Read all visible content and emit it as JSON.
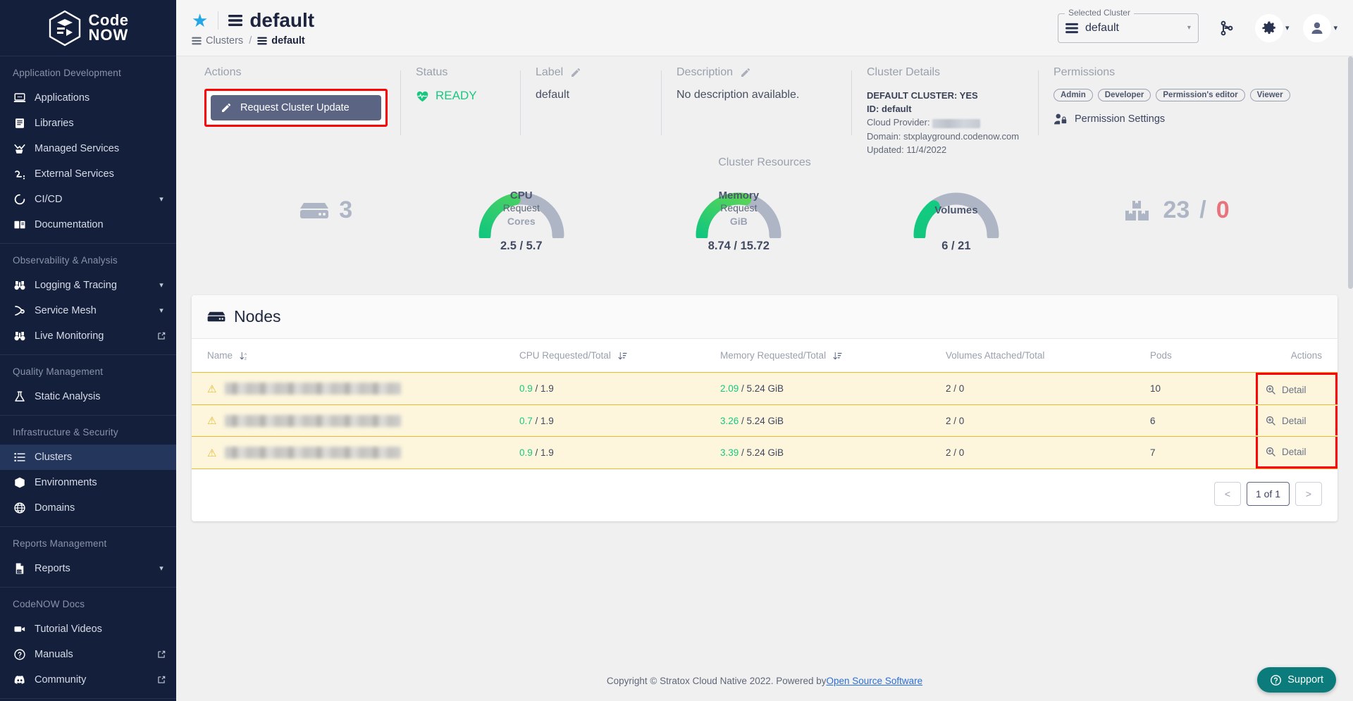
{
  "brand": {
    "name_line1": "Code",
    "name_line2": "NOW"
  },
  "sidebar": {
    "sections": [
      {
        "label": "Application Development",
        "items": [
          {
            "label": "Applications",
            "icon": "laptop-code-icon",
            "tail": ""
          },
          {
            "label": "Libraries",
            "icon": "book-icon",
            "tail": ""
          },
          {
            "label": "Managed Services",
            "icon": "managed-services-icon",
            "tail": ""
          },
          {
            "label": "External Services",
            "icon": "external-services-icon",
            "tail": ""
          },
          {
            "label": "CI/CD",
            "icon": "circle-loop-icon",
            "tail": "chevron-down-icon"
          },
          {
            "label": "Documentation",
            "icon": "open-book-icon",
            "tail": ""
          }
        ]
      },
      {
        "label": "Observability & Analysis",
        "items": [
          {
            "label": "Logging & Tracing",
            "icon": "binoculars-icon",
            "tail": "chevron-down-icon"
          },
          {
            "label": "Service Mesh",
            "icon": "service-mesh-icon",
            "tail": "chevron-down-icon"
          },
          {
            "label": "Live Monitoring",
            "icon": "binoculars-icon",
            "tail": "external-link-icon"
          }
        ]
      },
      {
        "label": "Quality Management",
        "items": [
          {
            "label": "Static Analysis",
            "icon": "flask-icon",
            "tail": ""
          }
        ]
      },
      {
        "label": "Infrastructure & Security",
        "items": [
          {
            "label": "Clusters",
            "icon": "list-icon",
            "tail": "",
            "active": true
          },
          {
            "label": "Environments",
            "icon": "cube-icon",
            "tail": ""
          },
          {
            "label": "Domains",
            "icon": "globe-icon",
            "tail": ""
          }
        ]
      },
      {
        "label": "Reports Management",
        "items": [
          {
            "label": "Reports",
            "icon": "csv-file-icon",
            "tail": "chevron-down-icon"
          }
        ]
      },
      {
        "label": "CodeNOW Docs",
        "items": [
          {
            "label": "Tutorial Videos",
            "icon": "video-camera-icon",
            "tail": ""
          },
          {
            "label": "Manuals",
            "icon": "question-circle-icon",
            "tail": "external-link-icon"
          },
          {
            "label": "Community",
            "icon": "discord-icon",
            "tail": "external-link-icon"
          }
        ]
      }
    ]
  },
  "header": {
    "title": "default",
    "favorite_icon": "star-icon",
    "breadcrumb": [
      {
        "label": "Clusters",
        "icon": "list-icon"
      },
      {
        "label": "default",
        "icon": "list-icon"
      }
    ],
    "breadcrumb_separator": "/",
    "selected_cluster": {
      "legend": "Selected Cluster",
      "value": "default"
    },
    "actions": [
      {
        "name": "git-branch-icon"
      },
      {
        "name": "gear-icon"
      },
      {
        "name": "user-icon"
      }
    ]
  },
  "info": {
    "actions": {
      "heading": "Actions",
      "button_label": "Request Cluster Update"
    },
    "status": {
      "heading": "Status",
      "value": "READY"
    },
    "label": {
      "heading": "Label",
      "value": "default"
    },
    "description": {
      "heading": "Description",
      "value": "No description available."
    },
    "cluster_details": {
      "heading": "Cluster Details",
      "default_cluster": "DEFAULT CLUSTER: YES",
      "id": "ID: default",
      "cloud_provider_label": "Cloud Provider:",
      "cloud_provider_value": "",
      "domain": "Domain: stxplayground.codenow.com",
      "updated": "Updated: 11/4/2022"
    },
    "permissions": {
      "heading": "Permissions",
      "chips": [
        "Admin",
        "Developer",
        "Permission's editor",
        "Viewer"
      ],
      "settings_label": "Permission Settings"
    }
  },
  "resources": {
    "title": "Cluster Resources",
    "nodes": {
      "icon": "server-icon",
      "count": "3"
    },
    "gauges": [
      {
        "name": "CPU",
        "sub": "Request",
        "unit": "Cores",
        "value": "2.5 / 5.7",
        "percent": 44
      },
      {
        "name": "Memory",
        "sub": "Request",
        "unit": "GiB",
        "value": "8.74 / 15.72",
        "percent": 56
      },
      {
        "name": "Volumes",
        "sub": "",
        "unit": "",
        "value": "6 / 21",
        "percent": 29
      }
    ],
    "pods": {
      "icon": "boxes-icon",
      "running": "23",
      "separator": "/",
      "failed": "0"
    }
  },
  "nodes_panel": {
    "title": "Nodes",
    "columns": [
      {
        "label": "Name",
        "sortable": true
      },
      {
        "label": "CPU Requested/Total",
        "sortable": true
      },
      {
        "label": "Memory Requested/Total",
        "sortable": true
      },
      {
        "label": "Volumes Attached/Total",
        "sortable": false
      },
      {
        "label": "Pods",
        "sortable": false
      },
      {
        "label": "Actions",
        "sortable": false
      }
    ],
    "rows": [
      {
        "name": "",
        "cpu_used": "0.9",
        "cpu_total": "1.9",
        "mem_used": "2.09",
        "mem_total": "5.24 GiB",
        "volumes": "2 / 0",
        "pods": "10",
        "action": "Detail"
      },
      {
        "name": "",
        "cpu_used": "0.7",
        "cpu_total": "1.9",
        "mem_used": "3.26",
        "mem_total": "5.24 GiB",
        "volumes": "2 / 0",
        "pods": "6",
        "action": "Detail"
      },
      {
        "name": "",
        "cpu_used": "0.9",
        "cpu_total": "1.9",
        "mem_used": "3.39",
        "mem_total": "5.24 GiB",
        "volumes": "2 / 0",
        "pods": "7",
        "action": "Detail"
      }
    ],
    "pagination": {
      "prev": "<",
      "current": "1 of 1",
      "next": ">"
    }
  },
  "footer": {
    "text": "Copyright © Stratox Cloud Native 2022. Powered by ",
    "link": "Open Source Software",
    "support_label": "Support"
  },
  "colors": {
    "sidebar_bg": "#141f3c",
    "accent_green": "#17c97f",
    "accent_blue": "#24a6e8",
    "highlight_red": "#ff0000",
    "warn_yellow": "#e8b931",
    "row_bg": "#fdf6dd",
    "danger_red": "#e8737d"
  }
}
